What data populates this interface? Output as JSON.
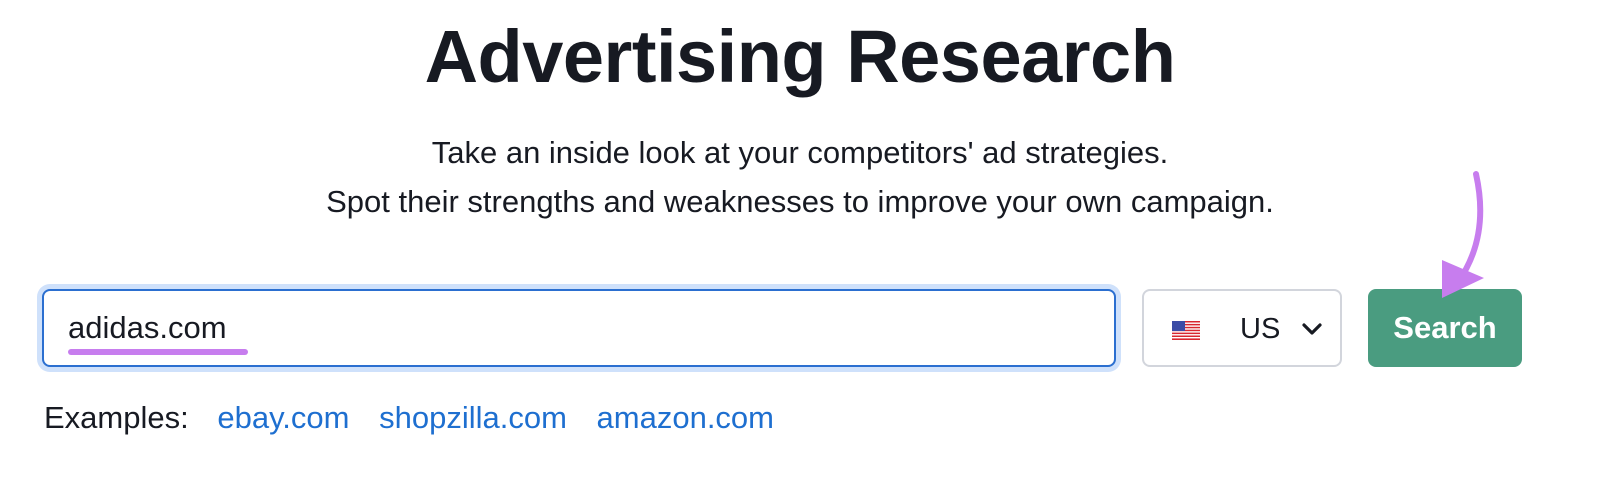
{
  "page": {
    "title": "Advertising Research",
    "subtitle_line1": "Take an inside look at your competitors' ad strategies.",
    "subtitle_line2": "Spot their strengths and weaknesses to improve your own campaign."
  },
  "search": {
    "value": "adidas.com",
    "button_label": "Search"
  },
  "country": {
    "selected": "US",
    "flag_icon": "us-flag-icon"
  },
  "examples": {
    "label": "Examples:",
    "links": [
      "ebay.com",
      "shopzilla.com",
      "amazon.com"
    ]
  },
  "colors": {
    "accent_button": "#4a9c80",
    "link": "#1e6fd0",
    "focus_border": "#2b6fd0",
    "highlight": "#c77dee"
  }
}
